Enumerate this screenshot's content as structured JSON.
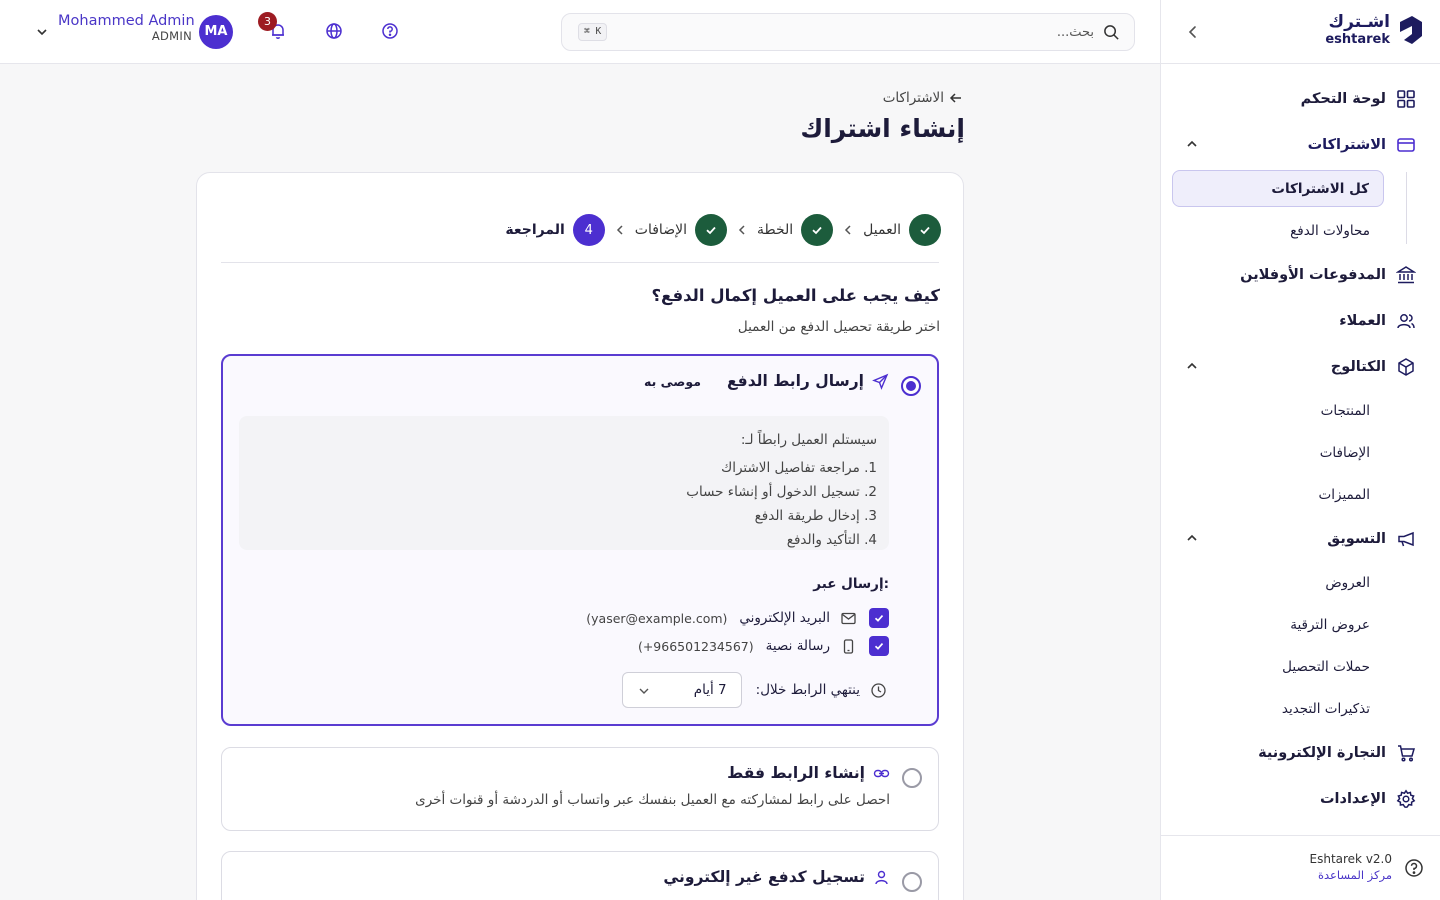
{
  "brand": {
    "name_ar": "اشـترك",
    "name_en": "eshtarek"
  },
  "colors": {
    "primary": "#4c2fd0",
    "success": "#1c5c3c",
    "badge": "#9d1b22",
    "brand_dark": "#1d1b5e"
  },
  "sidebar": {
    "items": [
      {
        "label": "لوحة التحكم",
        "icon": "dashboard-grid-icon"
      },
      {
        "label": "الاشتراكات",
        "icon": "credit-card-icon",
        "expanded": true,
        "children": [
          {
            "label": "كل الاشتراكات",
            "selected": true
          },
          {
            "label": "محاولات الدفع"
          }
        ]
      },
      {
        "label": "المدفوعات الأوفلاين",
        "icon": "bank-icon"
      },
      {
        "label": "العملاء",
        "icon": "users-icon"
      },
      {
        "label": "الكتالوج",
        "icon": "box-icon",
        "expanded": true,
        "children": [
          {
            "label": "المنتجات"
          },
          {
            "label": "الإضافات"
          },
          {
            "label": "المميزات"
          }
        ]
      },
      {
        "label": "التسويق",
        "icon": "megaphone-icon",
        "expanded": true,
        "children": [
          {
            "label": "العروض"
          },
          {
            "label": "عروض الترقية"
          },
          {
            "label": "حملات التحصيل"
          },
          {
            "label": "تذكيرات التجديد"
          }
        ]
      },
      {
        "label": "التجارة الإلكترونية",
        "icon": "cart-icon"
      },
      {
        "label": "الإعدادات",
        "icon": "gear-icon"
      }
    ],
    "footer": {
      "version": "Eshtarek v2.0",
      "help": "مركز المساعدة"
    }
  },
  "topbar": {
    "search_placeholder": "بحث...",
    "shortcut": "⌘ K",
    "notifications_count": "3",
    "user": {
      "name": "Mohammed Admin",
      "role": "ADMIN",
      "initials": "MA"
    }
  },
  "page": {
    "breadcrumb": "الاشتراكات",
    "title": "إنشاء اشتراك"
  },
  "stepper": [
    {
      "label": "العميل",
      "state": "done"
    },
    {
      "label": "الخطة",
      "state": "done"
    },
    {
      "label": "الإضافات",
      "state": "done"
    },
    {
      "label": "المراجعة",
      "state": "current",
      "number": "4"
    }
  ],
  "question": {
    "title": "كيف يجب على العميل إكمال الدفع؟",
    "subtitle": "اختر طريقة تحصيل الدفع من العميل"
  },
  "options": {
    "send_link": {
      "title": "إرسال رابط الدفع",
      "badge": "موصى به",
      "selected": true,
      "intro": "سيستلم العميل رابطاً لـ:",
      "steps": [
        "1. مراجعة تفاصيل الاشتراك",
        "2. تسجيل الدخول أو إنشاء حساب",
        "3. إدخال طريقة الدفع",
        "4. التأكيد والدفع"
      ],
      "send_via_label": "إرسال عبر:",
      "channels": [
        {
          "name": "البريد الإلكتروني",
          "value": "(yaser@example.com)",
          "checked": true,
          "icon": "mail-icon"
        },
        {
          "name": "رسالة نصية",
          "value": "(+966501234567)",
          "checked": true,
          "icon": "phone-icon"
        }
      ],
      "expire_label": "ينتهي الرابط خلال:",
      "expire_value": "7 أيام"
    },
    "create_link": {
      "title": "إنشاء الرابط فقط",
      "description": "احصل على رابط لمشاركته مع العميل بنفسك عبر واتساب أو الدردشة أو قنوات أخرى"
    },
    "offline": {
      "title": "تسجيل كدفع غير إلكتروني"
    }
  }
}
